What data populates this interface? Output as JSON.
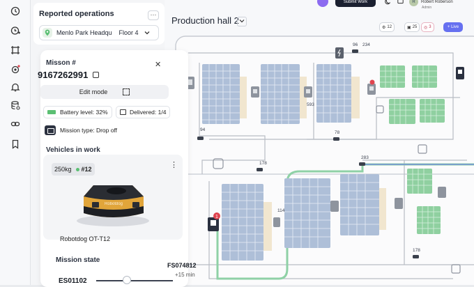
{
  "sidebar": {
    "icons": [
      "history-icon",
      "clock-plus-icon",
      "crop-icon",
      "robot-settings-icon",
      "bell-icon",
      "database-icon",
      "link-icon",
      "bookmark-icon"
    ]
  },
  "operations": {
    "title": "Reported operations",
    "more_label": "···",
    "location": "Menlo Park Headqu",
    "floor": "Floor 4"
  },
  "mission": {
    "label": "Misson #",
    "number": "9167262991",
    "edit_mode_label": "Edit mode",
    "battery": "Battery level: 32%",
    "delivered": "Delivered: 1/4",
    "mission_type": "Mission type: Drop off",
    "vehicles_label": "Vehicles in work",
    "vehicle": {
      "weight": "250kg",
      "id": "#12",
      "name": "Robotdog OT-T12",
      "body_label": "Robotdog"
    },
    "state_label": "Mission state",
    "start_code": "ES01102",
    "end_code": "FS074812",
    "eta": "+15 min",
    "progress": 0.4
  },
  "map": {
    "title": "Production hall 2",
    "submit_label": "Submit Work",
    "user_name": "Robert Roberson",
    "user_role": "Admin",
    "filters": [
      {
        "label": "12"
      },
      {
        "label": "25"
      },
      {
        "label": "3"
      }
    ],
    "live_label": "+ Live",
    "labels": {
      "n96": "96",
      "n234": "234",
      "n94": "94",
      "n593": "593",
      "n78": "78",
      "n178a": "178",
      "n283": "283",
      "n114": "114",
      "n178b": "178",
      "badge1": "1"
    },
    "colors": {
      "route": "#8fd1a6",
      "blue_rack": "#aebfd8",
      "green_rack": "#8fd0a0",
      "accent": "#6670f0"
    }
  }
}
